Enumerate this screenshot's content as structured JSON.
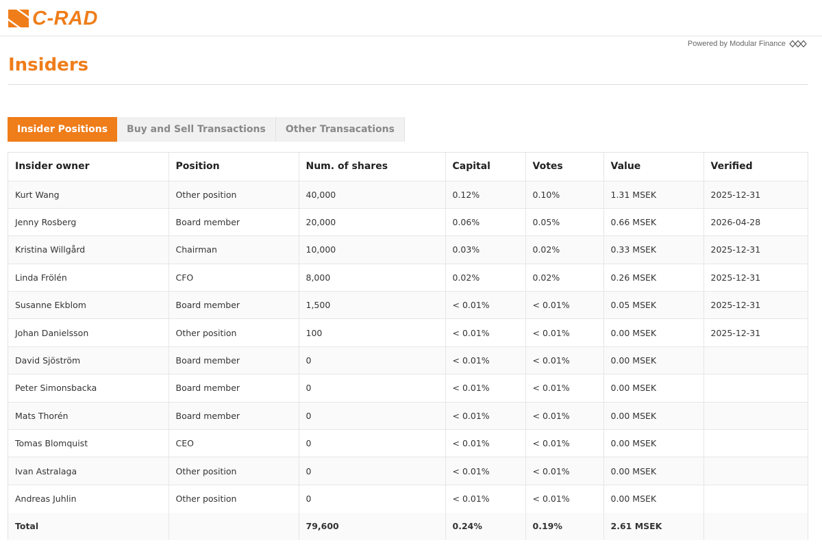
{
  "brand": {
    "logo_text": "C-RAD",
    "accent_color": "#ef7d1a",
    "logo_icon": "c-rad-logo-icon"
  },
  "powered_by": {
    "text": "Powered by Modular Finance",
    "icon": "modular-finance-logo-icon"
  },
  "page": {
    "title": "Insiders"
  },
  "tabs": [
    {
      "label": "Insider Positions",
      "active": true
    },
    {
      "label": "Buy and Sell Transactions",
      "active": false
    },
    {
      "label": "Other Transacations",
      "active": false
    }
  ],
  "table": {
    "headers": [
      "Insider owner",
      "Position",
      "Num. of shares",
      "Capital",
      "Votes",
      "Value",
      "Verified"
    ],
    "rows": [
      [
        "Kurt Wang",
        "Other position",
        "40,000",
        "0.12%",
        "0.10%",
        "1.31 MSEK",
        "2025-12-31"
      ],
      [
        "Jenny Rosberg",
        "Board member",
        "20,000",
        "0.06%",
        "0.05%",
        "0.66 MSEK",
        "2026-04-28"
      ],
      [
        "Kristina Willgård",
        "Chairman",
        "10,000",
        "0.03%",
        "0.02%",
        "0.33 MSEK",
        "2025-12-31"
      ],
      [
        "Linda Frölén",
        "CFO",
        "8,000",
        "0.02%",
        "0.02%",
        "0.26 MSEK",
        "2025-12-31"
      ],
      [
        "Susanne Ekblom",
        "Board member",
        "1,500",
        "< 0.01%",
        "< 0.01%",
        "0.05 MSEK",
        "2025-12-31"
      ],
      [
        "Johan Danielsson",
        "Other position",
        "100",
        "< 0.01%",
        "< 0.01%",
        "0.00 MSEK",
        "2025-12-31"
      ],
      [
        "David Sjöström",
        "Board member",
        "0",
        "< 0.01%",
        "< 0.01%",
        "0.00 MSEK",
        ""
      ],
      [
        "Peter Simonsbacka",
        "Board member",
        "0",
        "< 0.01%",
        "< 0.01%",
        "0.00 MSEK",
        ""
      ],
      [
        "Mats Thorén",
        "Board member",
        "0",
        "< 0.01%",
        "< 0.01%",
        "0.00 MSEK",
        ""
      ],
      [
        "Tomas Blomquist",
        "CEO",
        "0",
        "< 0.01%",
        "< 0.01%",
        "0.00 MSEK",
        ""
      ],
      [
        "Ivan Astralaga",
        "Other position",
        "0",
        "< 0.01%",
        "< 0.01%",
        "0.00 MSEK",
        ""
      ],
      [
        "Andreas Juhlin",
        "Other position",
        "0",
        "< 0.01%",
        "< 0.01%",
        "0.00 MSEK",
        ""
      ]
    ],
    "total": [
      "Total",
      "",
      "79,600",
      "0.24%",
      "0.19%",
      "2.61 MSEK",
      ""
    ]
  }
}
